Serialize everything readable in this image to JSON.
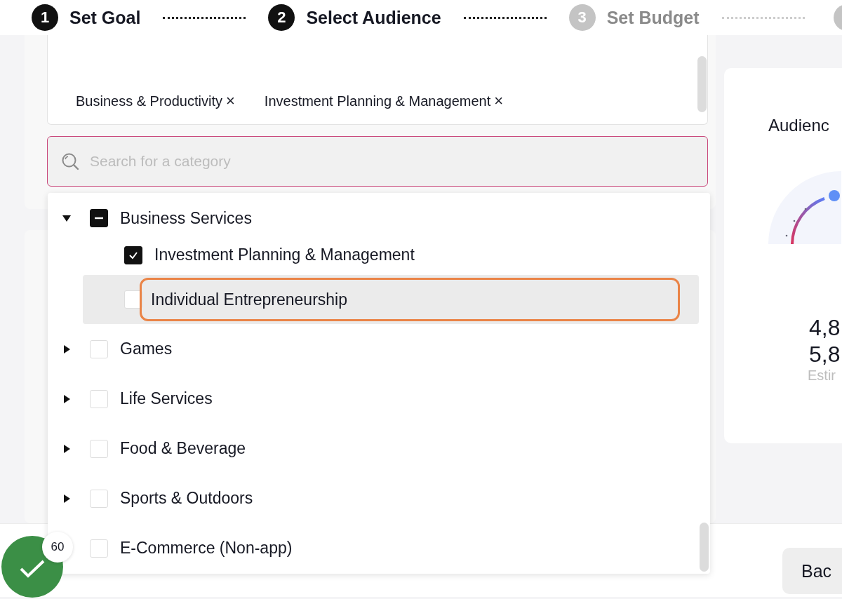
{
  "steps": [
    {
      "number": "1",
      "label": "Set Goal",
      "enabled": true
    },
    {
      "number": "2",
      "label": "Select Audience",
      "enabled": true
    },
    {
      "number": "3",
      "label": "Set Budget",
      "enabled": false
    }
  ],
  "selected_tags": [
    {
      "label": "Business & Productivity",
      "remove": "×"
    },
    {
      "label": "Investment Planning & Management",
      "remove": "×"
    }
  ],
  "search": {
    "placeholder": "Search for a category"
  },
  "categories": [
    {
      "label": "Business Services",
      "expanded": true,
      "checked": true,
      "partial": true,
      "selected": false,
      "children": [
        {
          "label": "Investment Planning & Management",
          "checked": true,
          "selected": false
        },
        {
          "label": "Individual Entrepreneurship",
          "checked": false,
          "selected": true
        }
      ]
    },
    {
      "label": "Games",
      "expanded": false,
      "checked": false,
      "partial": false,
      "selected": false
    },
    {
      "label": "Life Services",
      "expanded": false,
      "checked": false,
      "partial": false,
      "selected": false
    },
    {
      "label": "Food & Beverage",
      "expanded": false,
      "checked": false,
      "partial": false,
      "selected": false
    },
    {
      "label": "Sports & Outdoors",
      "expanded": false,
      "checked": false,
      "partial": false,
      "selected": false
    },
    {
      "label": "E-Commerce (Non-app)",
      "checked": false,
      "partial": false,
      "selected": false
    }
  ],
  "audience_card": {
    "title": "Audienc",
    "range_low": "4,8",
    "range_high": "5,8",
    "caption": "Estir"
  },
  "progress_badge": {
    "count": "60"
  },
  "back_button": "Bac"
}
